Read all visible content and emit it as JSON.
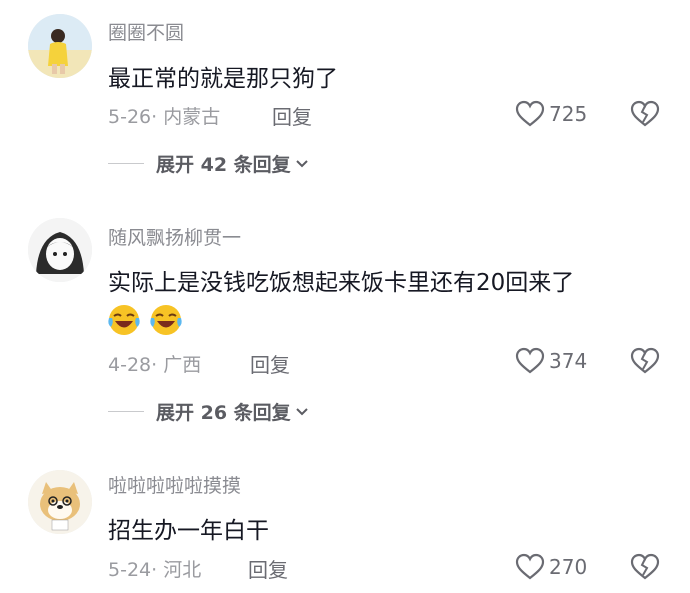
{
  "comments": [
    {
      "username": "圈圈不圆",
      "text": "最正常的就是那只狗了",
      "date": "5-26",
      "location": "内蒙古",
      "reply_label": "回复",
      "likes": "725",
      "expand_label": "展开 42 条回复"
    },
    {
      "username": "随风飘扬柳贯一",
      "text": "实际上是没钱吃饭想起来饭卡里还有20回来了",
      "date": "4-28",
      "location": "广西",
      "reply_label": "回复",
      "likes": "374",
      "expand_label": "展开 26 条回复",
      "emojis": [
        "laugh-cry-emoji",
        "laugh-cry-emoji"
      ]
    },
    {
      "username": "啦啦啦啦啦摸摸",
      "text": "招生办一年白干",
      "date": "5-24",
      "location": "河北",
      "reply_label": "回复",
      "likes": "270"
    }
  ],
  "colors": {
    "text": "#161823",
    "secondary": "#8a8b91",
    "icon": "#6a6b72"
  }
}
